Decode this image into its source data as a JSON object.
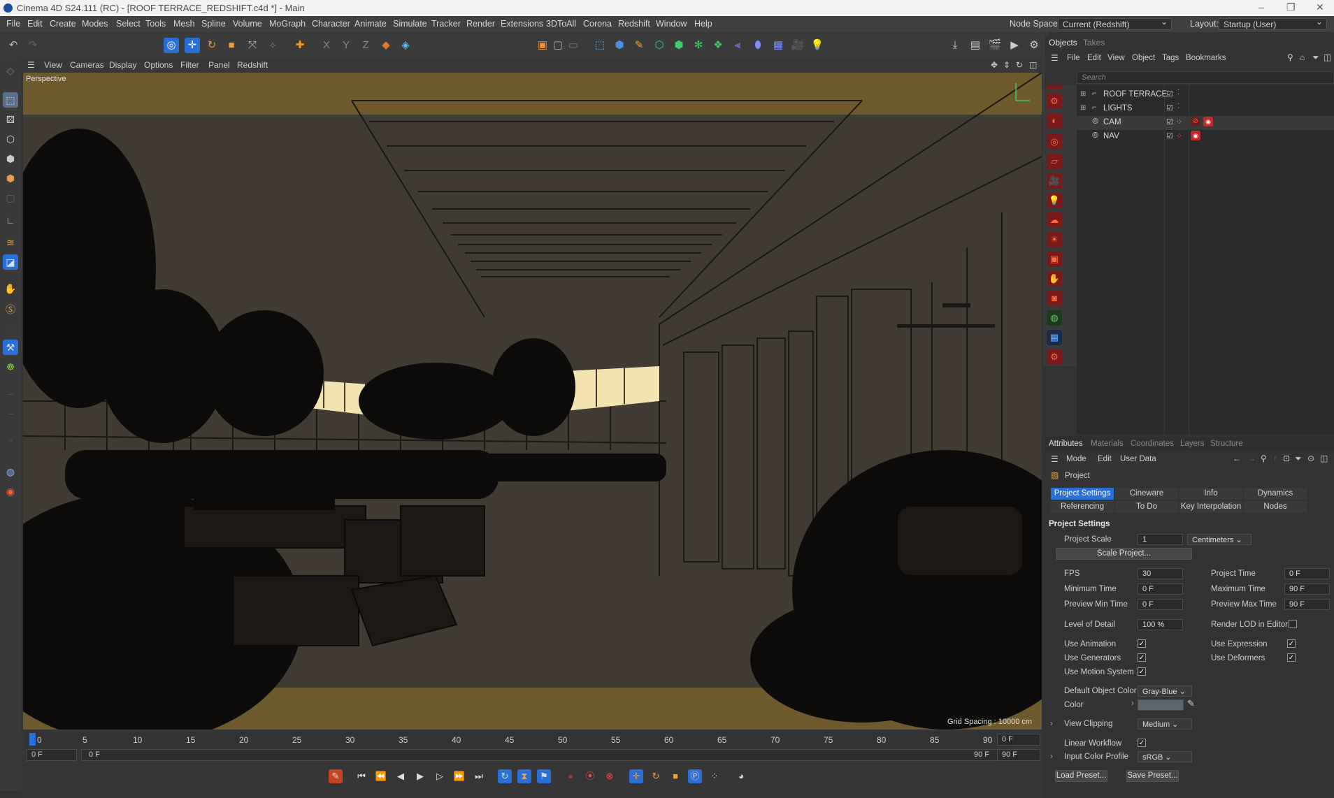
{
  "app": {
    "title": "Cinema 4D S24.111 (RC) - [ROOF TERRACE_REDSHIFT.c4d *] - Main"
  },
  "menu": {
    "items": [
      "File",
      "Edit",
      "Create",
      "Modes",
      "Select",
      "Tools",
      "Mesh",
      "Spline",
      "Volume",
      "MoGraph",
      "Character",
      "Animate",
      "Simulate",
      "Tracker",
      "Render",
      "Extensions",
      "3DToAll",
      "Corona",
      "Redshift",
      "Window",
      "Help"
    ],
    "node_space_label": "Node Space:",
    "node_space_value": "Current (Redshift)",
    "layout_label": "Layout:",
    "layout_value": "Startup (User)"
  },
  "viewport": {
    "menu": [
      "View",
      "Cameras",
      "Display",
      "Options",
      "Filter",
      "Panel",
      "Redshift"
    ],
    "camera_label": "Perspective",
    "grid_spacing": "Grid Spacing : 10000 cm"
  },
  "timeline": {
    "ticks": [
      "0",
      "5",
      "10",
      "15",
      "20",
      "25",
      "30",
      "35",
      "40",
      "45",
      "50",
      "55",
      "60",
      "65",
      "70",
      "75",
      "80",
      "85",
      "90"
    ],
    "current_frame": "0 F",
    "start_frame": "0 F",
    "range_start": "0 F",
    "range_end": "90 F",
    "end_frame": "90 F",
    "end_frame2": "90 F"
  },
  "objects": {
    "tabs": [
      "Objects",
      "Takes"
    ],
    "menu": [
      "File",
      "Edit",
      "View",
      "Object",
      "Tags",
      "Bookmarks"
    ],
    "search_placeholder": "Search",
    "rows": [
      {
        "name": "ROOF TERRACE",
        "type": "group"
      },
      {
        "name": "LIGHTS",
        "type": "group"
      },
      {
        "name": "CAM",
        "type": "camera"
      },
      {
        "name": "NAV",
        "type": "camera"
      }
    ]
  },
  "attributes": {
    "tabs": [
      "Attributes",
      "Materials",
      "Coordinates",
      "Layers",
      "Structure"
    ],
    "menu": [
      "Mode",
      "Edit",
      "User Data"
    ],
    "object_title": "Project",
    "subtabs_row1": [
      "Project Settings",
      "Cineware",
      "Info",
      "Dynamics"
    ],
    "subtabs_row2": [
      "Referencing",
      "To Do",
      "Key Interpolation",
      "Nodes"
    ],
    "section_title": "Project Settings",
    "project_scale_label": "Project Scale",
    "project_scale_value": "1",
    "project_scale_unit": "Centimeters",
    "scale_project_button": "Scale Project...",
    "fps_label": "FPS",
    "fps_value": "30",
    "project_time_label": "Project Time",
    "project_time_value": "0 F",
    "min_time_label": "Minimum Time",
    "min_time_value": "0 F",
    "max_time_label": "Maximum Time",
    "max_time_value": "90 F",
    "preview_min_label": "Preview Min Time",
    "preview_min_value": "0 F",
    "preview_max_label": "Preview Max Time",
    "preview_max_value": "90 F",
    "lod_label": "Level of Detail",
    "lod_value": "100 %",
    "render_lod_label": "Render LOD in Editor",
    "use_animation_label": "Use Animation",
    "use_expression_label": "Use Expression",
    "use_generators_label": "Use Generators",
    "use_deformers_label": "Use Deformers",
    "use_motion_label": "Use Motion System",
    "default_color_label": "Default Object Color",
    "default_color_value": "Gray-Blue",
    "color_label": "Color",
    "view_clipping_label": "View Clipping",
    "view_clipping_value": "Medium",
    "linear_workflow_label": "Linear Workflow",
    "input_color_label": "Input Color Profile",
    "input_color_value": "sRGB",
    "load_preset": "Load Preset...",
    "save_preset": "Save Preset..."
  },
  "colors": {
    "accent": "#2a6fd6",
    "viewport_bg": "#413b33",
    "band": "#6e5a2c",
    "string_lights": "#f2e3b0"
  }
}
